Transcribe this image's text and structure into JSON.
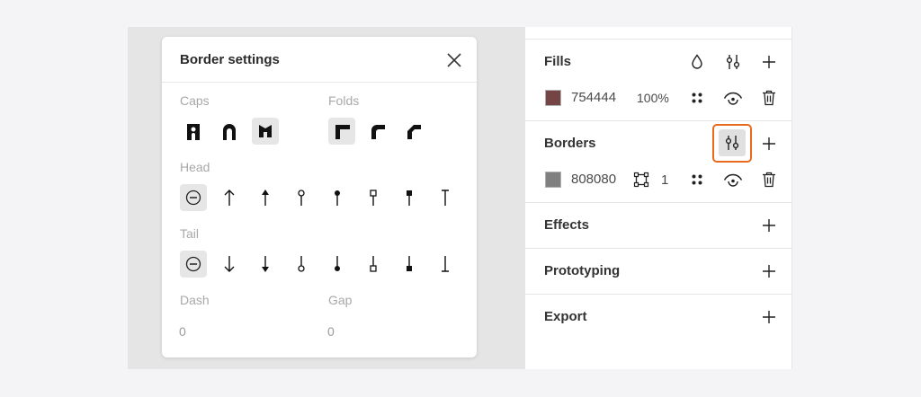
{
  "modal": {
    "title": "Border settings",
    "caps_label": "Caps",
    "folds_label": "Folds",
    "head_label": "Head",
    "tail_label": "Tail",
    "dash_label": "Dash",
    "gap_label": "Gap",
    "dash_value": "0",
    "gap_value": "0",
    "selected_cap": "square",
    "selected_fold": "miter",
    "selected_head": "none",
    "selected_tail": "none"
  },
  "panel": {
    "fills": {
      "title": "Fills",
      "color": "754444",
      "swatch_hex": "#754444",
      "opacity": "100%"
    },
    "borders": {
      "title": "Borders",
      "color": "808080",
      "swatch_hex": "#808080",
      "width": "1"
    },
    "effects_title": "Effects",
    "prototyping_title": "Prototyping",
    "export_title": "Export"
  },
  "colors": {
    "highlight": "#e86a1f"
  }
}
